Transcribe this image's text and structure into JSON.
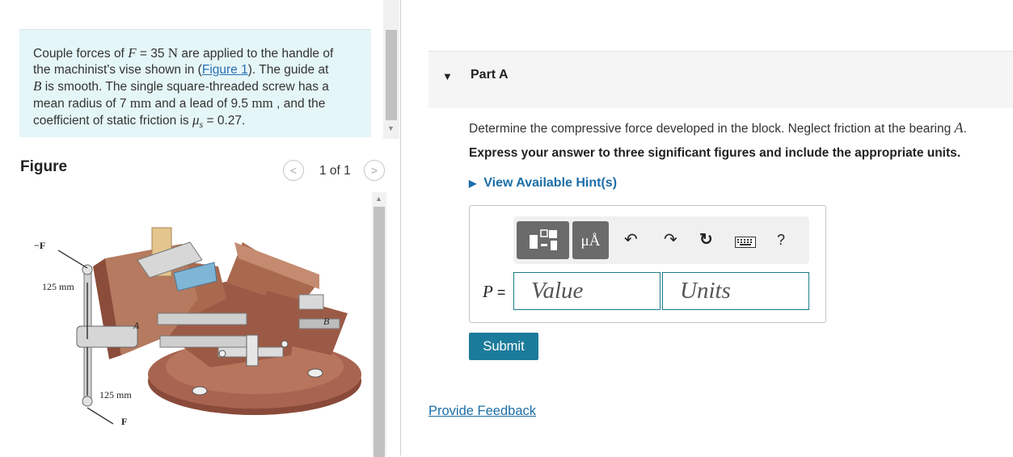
{
  "problem": {
    "l1a": "Couple forces of ",
    "l1_var": "F",
    "l1b": " = 35 ",
    "l1_unit": "N",
    "l1c": " are applied to the handle of",
    "l2a": "the machinist's vise shown in (",
    "l2_link": "Figure 1",
    "l2b": "). The guide at",
    "l3_var": "B",
    "l3b": " is smooth. The single square-threaded screw has a",
    "l4a": "mean radius of 7 ",
    "l4_unit": "mm",
    "l4b": " and a lead of 9.5 ",
    "l4_unit2": "mm",
    "l4c": " , and the",
    "l5a": "coefficient of static friction is ",
    "l5_var": "μ",
    "l5_sub": "s",
    "l5b": " = 0.27."
  },
  "figure": {
    "title": "Figure",
    "prev_icon": "chevron-left-icon",
    "next_icon": "chevron-right-icon",
    "prev_glyph": "<",
    "next_glyph": ">",
    "count": "1 of 1",
    "labels": {
      "neg_f": "−F",
      "dim_top": "125 mm",
      "a": "A",
      "b": "B",
      "dim_bottom": "125 mm",
      "f": "F"
    }
  },
  "part": {
    "caret_glyph": "▼",
    "title": "Part A",
    "question_a": "Determine the compressive force developed in the block. Neglect friction at the bearing ",
    "question_var": "A",
    "question_b": ".",
    "instruction": "Express your answer to three significant figures and include the appropriate units.",
    "hint_glyph": "▶",
    "hint_label": "View Available Hint(s)"
  },
  "answer": {
    "toolbar": {
      "templates_icon": "templates-icon",
      "units_icon": "units-icon",
      "units_glyph": "μÅ",
      "undo_icon": "undo-icon",
      "undo_glyph": "↶",
      "redo_icon": "redo-icon",
      "redo_glyph": "↷",
      "reset_icon": "reset-icon",
      "reset_glyph": "↻",
      "keyboard_icon": "keyboard-icon",
      "help_glyph": "?"
    },
    "label_var": "P",
    "label_eq": " =",
    "value_placeholder": "Value",
    "units_placeholder": "Units",
    "submit": "Submit"
  },
  "feedback": "Provide Feedback"
}
